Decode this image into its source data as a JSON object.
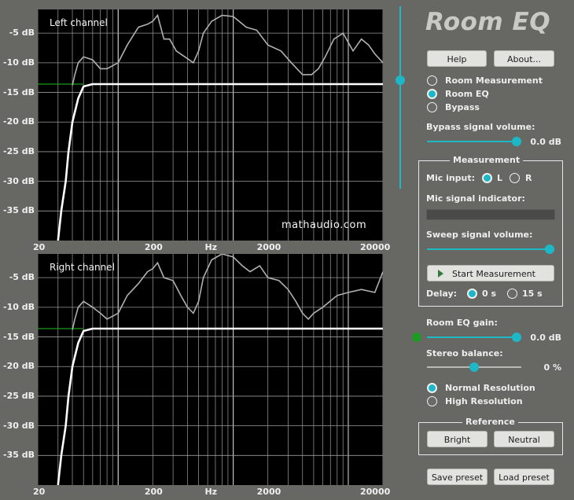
{
  "app": {
    "title": "Room EQ",
    "help_label": "Help",
    "about_label": "About...",
    "save_label": "Save preset",
    "load_label": "Load preset"
  },
  "colors": {
    "accent": "#1cb8c8",
    "background": "#676764",
    "plot_background": "#000000",
    "target_line": "#ffffff",
    "response_line": "#b0b0b0",
    "left_marker": "#1a9a1a"
  },
  "mode": {
    "options": [
      "Room Measurement",
      "Room EQ",
      "Bypass"
    ],
    "selected": "Room EQ"
  },
  "bypass": {
    "label": "Bypass signal volume:",
    "value_text": "0.0 dB",
    "level": 0.93
  },
  "measurement": {
    "group_title": "Measurement",
    "mic_input_label": "Mic input:",
    "mic_options": [
      "L",
      "R"
    ],
    "mic_selected": "L",
    "mic_indicator_label": "Mic signal indicator:",
    "sweep_label": "Sweep signal volume:",
    "sweep_level": 1.0,
    "start_label": "Start Measurement",
    "play_icon": "play-icon",
    "delay_label": "Delay:",
    "delay_options": [
      "0 s",
      "15 s"
    ],
    "delay_selected": "0 s"
  },
  "eq_gain": {
    "label": "Room EQ gain:",
    "value_text": "0.0 dB",
    "level": 0.93
  },
  "stereo": {
    "label": "Stereo balance:",
    "value_text": "0 %",
    "level": 0.5
  },
  "resolution": {
    "options": [
      "Normal Resolution",
      "High Resolution"
    ],
    "selected": "Normal Resolution"
  },
  "reference": {
    "group_title": "Reference",
    "bright_label": "Bright",
    "neutral_label": "Neutral"
  },
  "vertical_slider": {
    "level": 0.62
  },
  "watermark": "mathaudio.com",
  "chart_data": [
    {
      "type": "line",
      "title": "Left channel",
      "xlabel": "Hz",
      "x_scale": "log",
      "xlim": [
        20,
        20000
      ],
      "ylim": [
        -40,
        -1
      ],
      "x_tick_labels": [
        "20",
        "200",
        "Hz",
        "2000",
        "20000"
      ],
      "y_tick_labels": [
        "-5 dB",
        "-10 dB",
        "-15 dB",
        "-20 dB",
        "-25 dB",
        "-30 dB",
        "-35 dB"
      ],
      "grid": true,
      "series": [
        {
          "role": "measured_response",
          "x": [
            40,
            42,
            45,
            50,
            60,
            70,
            80,
            100,
            120,
            150,
            180,
            200,
            220,
            250,
            280,
            320,
            380,
            450,
            500,
            550,
            650,
            800,
            1000,
            1300,
            1600,
            2000,
            2600,
            3200,
            4000,
            4800,
            5500,
            6300,
            7500,
            9000,
            11000,
            13000,
            15000,
            17000,
            20000
          ],
          "y": [
            -13.8,
            -12,
            -10,
            -9,
            -9.5,
            -11,
            -11,
            -10,
            -7,
            -4,
            -3.5,
            -3,
            -2,
            -6,
            -6,
            -8,
            -9,
            -10,
            -8,
            -5,
            -3,
            -2,
            -2.2,
            -4,
            -4.5,
            -7,
            -8,
            -10,
            -12,
            -12,
            -11,
            -9,
            -6,
            -5,
            -8,
            -6,
            -7,
            -8.5,
            -10
          ]
        },
        {
          "role": "eq_target",
          "x": [
            30,
            32,
            35,
            37,
            40,
            45,
            50,
            60,
            100,
            1000,
            10000,
            20000
          ],
          "y": [
            -40,
            -35,
            -30,
            -25,
            -20,
            -16,
            -14,
            -13.6,
            -13.6,
            -13.6,
            -13.6,
            -13.6
          ]
        }
      ]
    },
    {
      "type": "line",
      "title": "Right channel",
      "xlabel": "Hz",
      "x_scale": "log",
      "xlim": [
        20,
        20000
      ],
      "ylim": [
        -40,
        -1
      ],
      "x_tick_labels": [
        "20",
        "200",
        "Hz",
        "2000",
        "20000"
      ],
      "y_tick_labels": [
        "-5 dB",
        "-10 dB",
        "-15 dB",
        "-20 dB",
        "-25 dB",
        "-30 dB",
        "-35 dB"
      ],
      "grid": true,
      "series": [
        {
          "role": "measured_response",
          "x": [
            40,
            42,
            45,
            50,
            60,
            70,
            80,
            100,
            120,
            150,
            180,
            200,
            220,
            250,
            300,
            350,
            400,
            450,
            500,
            550,
            650,
            800,
            1000,
            1200,
            1400,
            1700,
            2000,
            2500,
            3000,
            3500,
            4000,
            4500,
            5000,
            6000,
            8000,
            10000,
            13000,
            17000,
            20000
          ],
          "y": [
            -13.8,
            -12,
            -10,
            -9,
            -10,
            -11,
            -12,
            -11,
            -8,
            -6,
            -4,
            -3.5,
            -2.5,
            -5,
            -5.5,
            -8,
            -10,
            -11,
            -9,
            -5,
            -2,
            -1,
            -1.5,
            -3,
            -4,
            -3,
            -5,
            -5.5,
            -7,
            -9,
            -11,
            -12,
            -11,
            -10,
            -8,
            -7.5,
            -7,
            -7.5,
            -4
          ]
        },
        {
          "role": "eq_target",
          "x": [
            30,
            32,
            35,
            37,
            40,
            45,
            50,
            60,
            100,
            1000,
            10000,
            20000
          ],
          "y": [
            -40,
            -35,
            -30,
            -25,
            -20,
            -16,
            -14,
            -13.6,
            -13.6,
            -13.6,
            -13.6,
            -13.6
          ]
        }
      ]
    }
  ]
}
